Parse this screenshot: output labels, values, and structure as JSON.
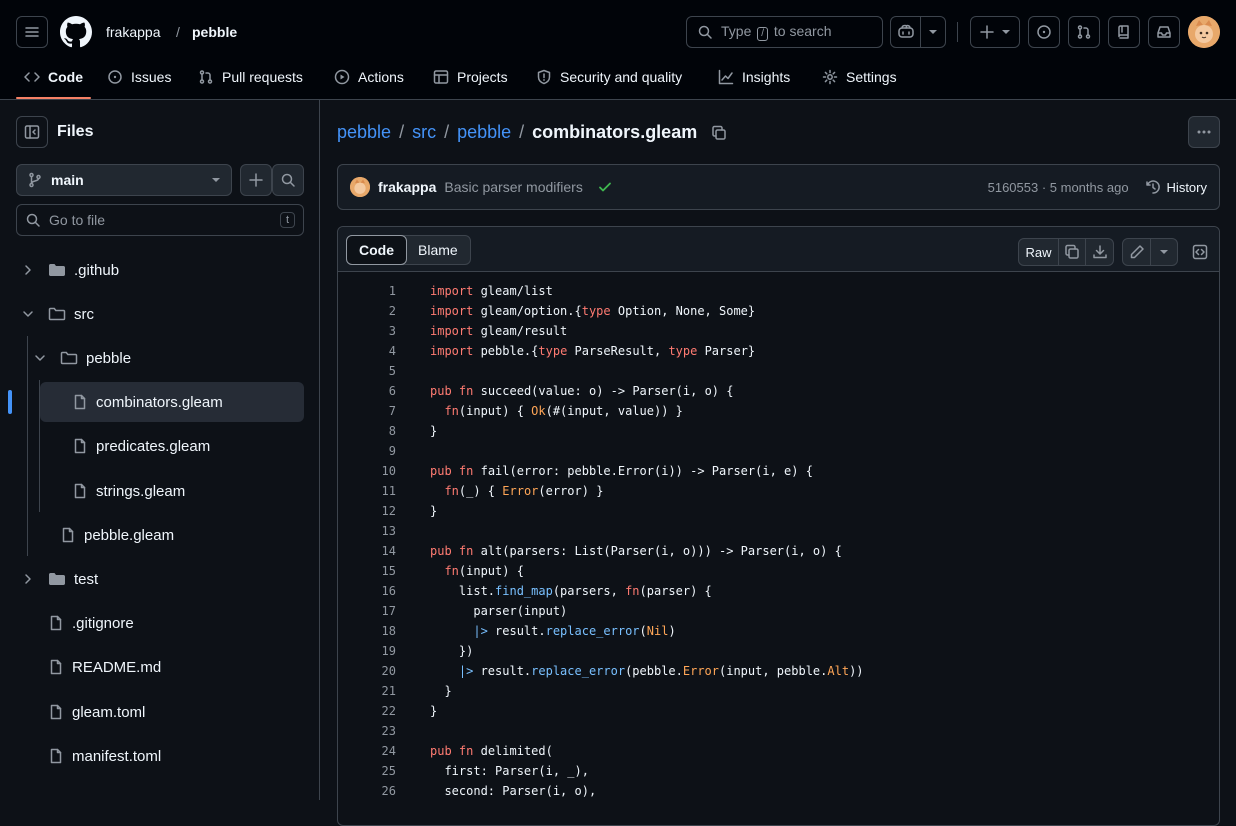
{
  "header": {
    "owner": "frakappa",
    "separator": "/",
    "repo": "pebble",
    "search_prefix": "Type",
    "search_key": "/",
    "search_suffix": "to search"
  },
  "tabs": [
    {
      "label": "Code"
    },
    {
      "label": "Issues"
    },
    {
      "label": "Pull requests"
    },
    {
      "label": "Actions"
    },
    {
      "label": "Projects"
    },
    {
      "label": "Security and quality"
    },
    {
      "label": "Insights"
    },
    {
      "label": "Settings"
    }
  ],
  "sidebar": {
    "title": "Files",
    "branch": "main",
    "goto_placeholder": "Go to file",
    "goto_key": "t",
    "tree": [
      {
        "label": ".github",
        "type": "folder",
        "expanded": false
      },
      {
        "label": "src",
        "type": "folder",
        "expanded": true
      },
      {
        "label": "pebble",
        "type": "folder",
        "expanded": true
      },
      {
        "label": "combinators.gleam",
        "type": "file",
        "selected": true
      },
      {
        "label": "predicates.gleam",
        "type": "file"
      },
      {
        "label": "strings.gleam",
        "type": "file"
      },
      {
        "label": "pebble.gleam",
        "type": "file"
      },
      {
        "label": "test",
        "type": "folder",
        "expanded": false
      },
      {
        "label": ".gitignore",
        "type": "file"
      },
      {
        "label": "README.md",
        "type": "file"
      },
      {
        "label": "gleam.toml",
        "type": "file"
      },
      {
        "label": "manifest.toml",
        "type": "file"
      }
    ]
  },
  "path": {
    "parts": [
      "pebble",
      "src",
      "pebble"
    ],
    "separator": "/",
    "file": "combinators.gleam"
  },
  "commit": {
    "author": "frakappa",
    "message": "Basic parser modifiers",
    "meta": "5160553 · 5 months ago",
    "history_label": "History"
  },
  "code_view": {
    "tab_code": "Code",
    "tab_blame": "Blame",
    "raw_label": "Raw"
  },
  "colors": {
    "accent": "#f78166",
    "link": "#4493f8",
    "keyword": "#ff7b72",
    "function": "#79c0ff",
    "constant": "#ffa657"
  },
  "code_lines": [
    [
      [
        "k",
        "import"
      ],
      [
        "t",
        " gleam/list"
      ]
    ],
    [
      [
        "k",
        "import"
      ],
      [
        "t",
        " gleam/option.{"
      ],
      [
        "k",
        "type"
      ],
      [
        "t",
        " Option, None, Some}"
      ]
    ],
    [
      [
        "k",
        "import"
      ],
      [
        "t",
        " gleam/result"
      ]
    ],
    [
      [
        "k",
        "import"
      ],
      [
        "t",
        " pebble.{"
      ],
      [
        "k",
        "type"
      ],
      [
        "t",
        " ParseResult, "
      ],
      [
        "k",
        "type"
      ],
      [
        "t",
        " Parser}"
      ]
    ],
    [],
    [
      [
        "k",
        "pub"
      ],
      [
        "t",
        " "
      ],
      [
        "k",
        "fn"
      ],
      [
        "t",
        " succeed(value: o) -> Parser(i, o) {"
      ]
    ],
    [
      [
        "t",
        "  "
      ],
      [
        "k",
        "fn"
      ],
      [
        "t",
        "(input) { "
      ],
      [
        "c",
        "Ok"
      ],
      [
        "t",
        "(#(input, value)) }"
      ]
    ],
    [
      [
        "t",
        "}"
      ]
    ],
    [],
    [
      [
        "k",
        "pub"
      ],
      [
        "t",
        " "
      ],
      [
        "k",
        "fn"
      ],
      [
        "t",
        " fail(error: pebble.Error(i)) -> Parser(i, e) {"
      ]
    ],
    [
      [
        "t",
        "  "
      ],
      [
        "k",
        "fn"
      ],
      [
        "t",
        "(_) { "
      ],
      [
        "c",
        "Error"
      ],
      [
        "t",
        "(error) }"
      ]
    ],
    [
      [
        "t",
        "}"
      ]
    ],
    [],
    [
      [
        "k",
        "pub"
      ],
      [
        "t",
        " "
      ],
      [
        "k",
        "fn"
      ],
      [
        "t",
        " alt(parsers: List(Parser(i, o))) -> Parser(i, o) {"
      ]
    ],
    [
      [
        "t",
        "  "
      ],
      [
        "k",
        "fn"
      ],
      [
        "t",
        "(input) {"
      ]
    ],
    [
      [
        "t",
        "    list."
      ],
      [
        "f",
        "find_map"
      ],
      [
        "t",
        "(parsers, "
      ],
      [
        "k",
        "fn"
      ],
      [
        "t",
        "(parser) {"
      ]
    ],
    [
      [
        "t",
        "      parser(input)"
      ]
    ],
    [
      [
        "t",
        "      "
      ],
      [
        "f",
        "|>"
      ],
      [
        "t",
        " result."
      ],
      [
        "f",
        "replace_error"
      ],
      [
        "t",
        "("
      ],
      [
        "c",
        "Nil"
      ],
      [
        "t",
        ")"
      ]
    ],
    [
      [
        "t",
        "    })"
      ]
    ],
    [
      [
        "t",
        "    "
      ],
      [
        "f",
        "|>"
      ],
      [
        "t",
        " result."
      ],
      [
        "f",
        "replace_error"
      ],
      [
        "t",
        "(pebble."
      ],
      [
        "c",
        "Error"
      ],
      [
        "t",
        "(input, pebble."
      ],
      [
        "c",
        "Alt"
      ],
      [
        "t",
        "))"
      ]
    ],
    [
      [
        "t",
        "  }"
      ]
    ],
    [
      [
        "t",
        "}"
      ]
    ],
    [],
    [
      [
        "k",
        "pub"
      ],
      [
        "t",
        " "
      ],
      [
        "k",
        "fn"
      ],
      [
        "t",
        " delimited("
      ]
    ],
    [
      [
        "t",
        "  first: Parser(i, _),"
      ]
    ],
    [
      [
        "t",
        "  second: Parser(i, o),"
      ]
    ]
  ]
}
